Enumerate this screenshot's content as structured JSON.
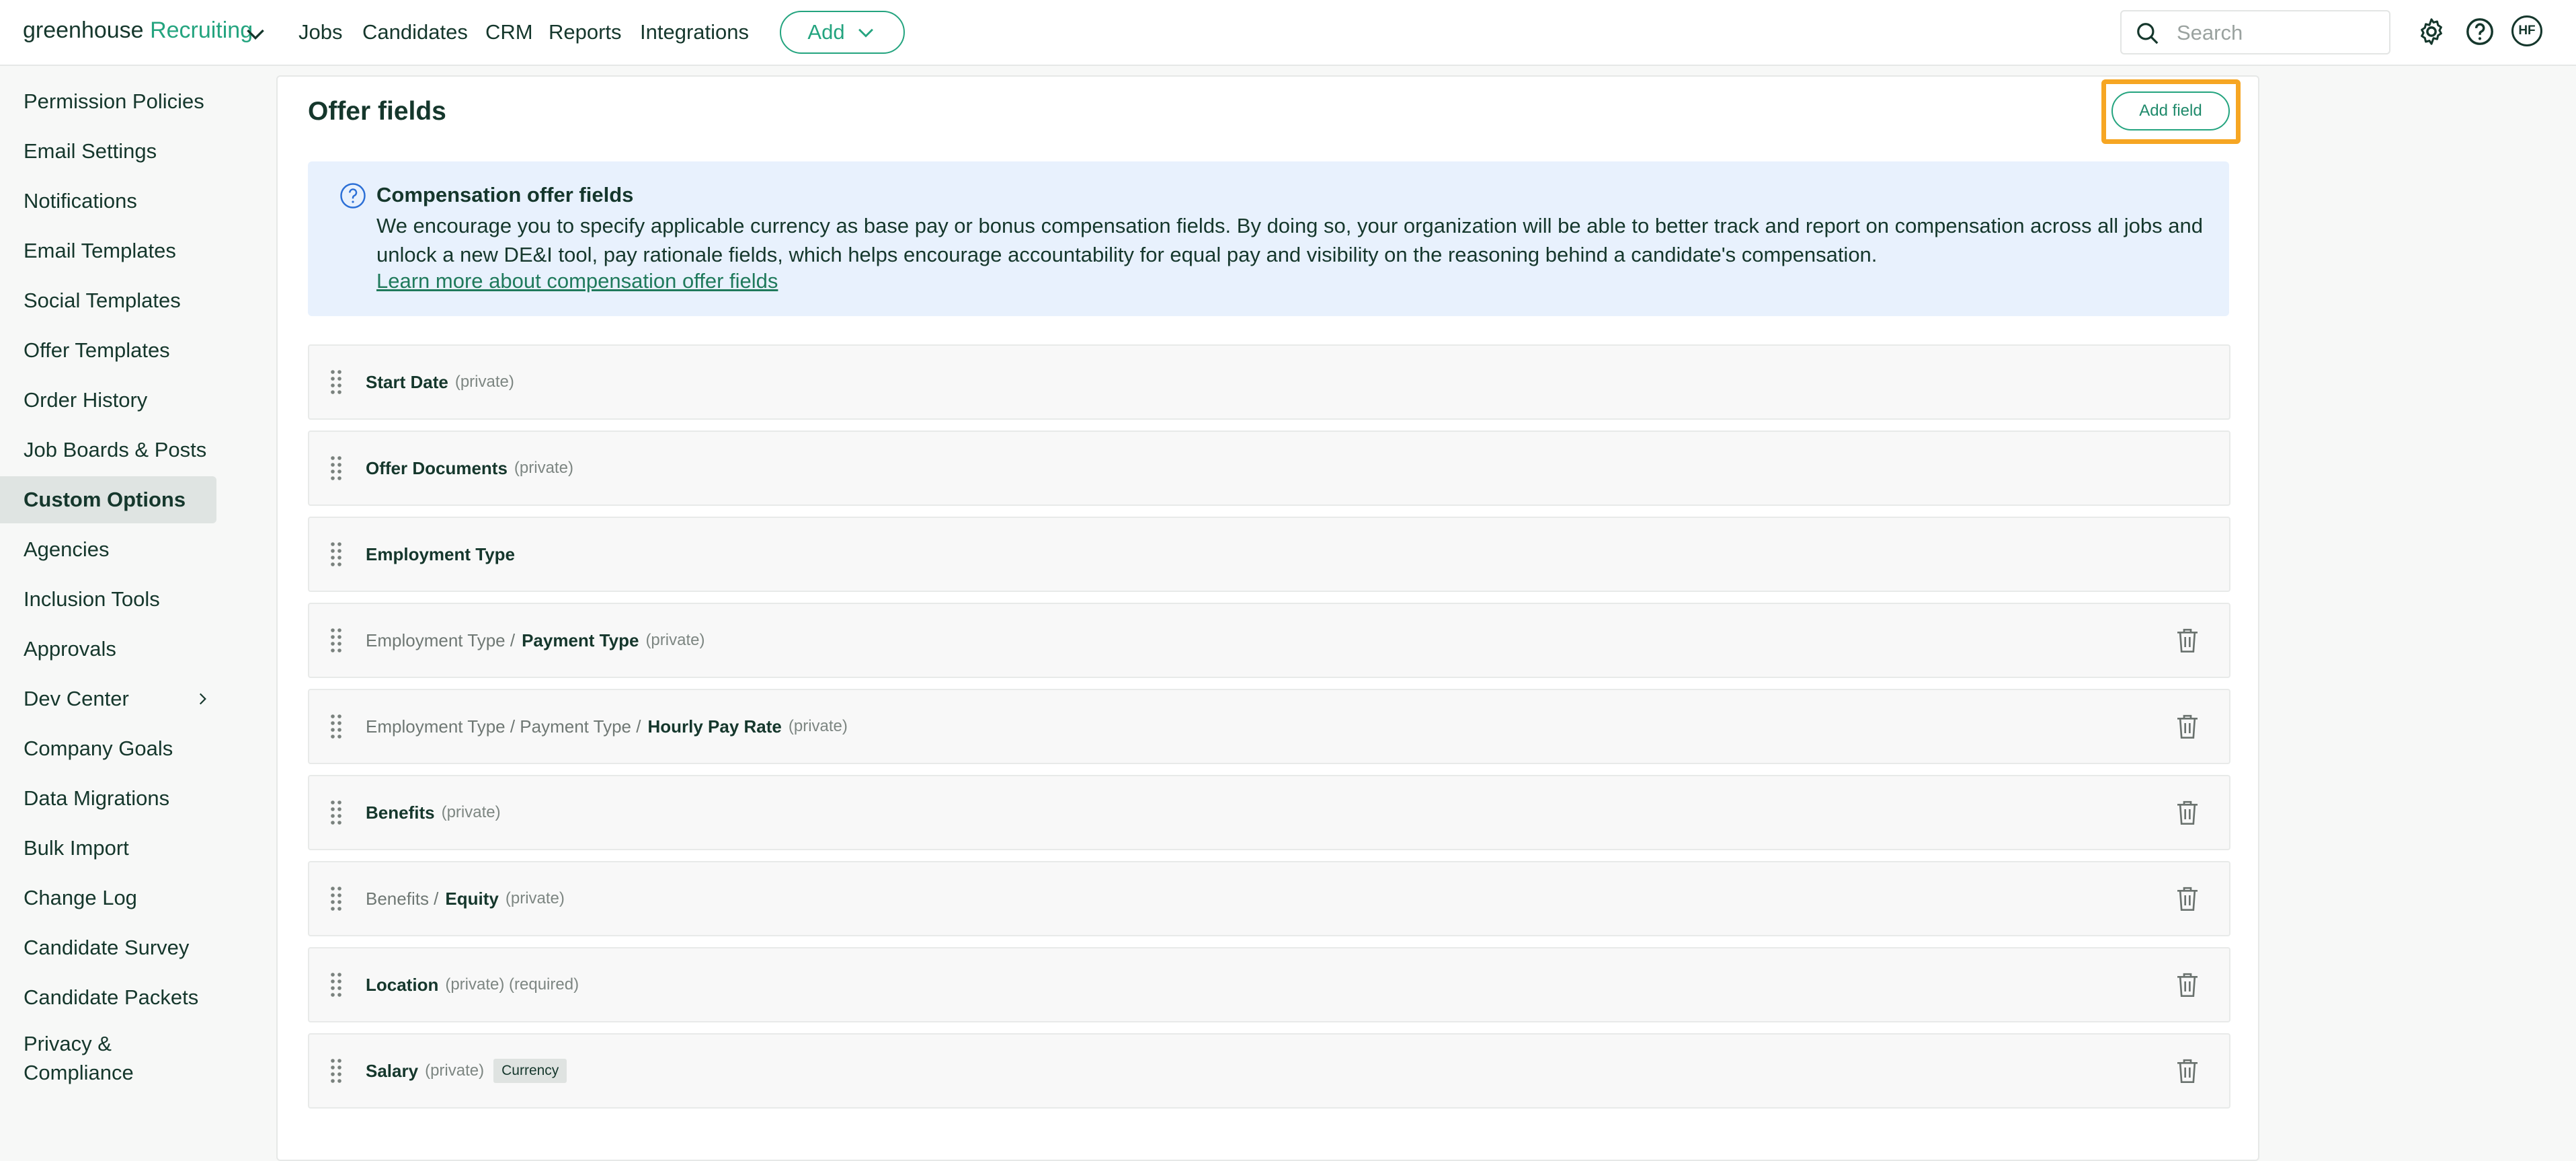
{
  "topnav": {
    "brand_main": "greenhouse",
    "brand_sub": "Recruiting",
    "links": [
      "Jobs",
      "Candidates",
      "CRM",
      "Reports",
      "Integrations"
    ],
    "add_label": "Add",
    "search_placeholder": "Search",
    "avatar_initials": "HF"
  },
  "sidebar": {
    "items": [
      "Permission Policies",
      "Email Settings",
      "Notifications",
      "Email Templates",
      "Social Templates",
      "Offer Templates",
      "Order History",
      "Job Boards & Posts",
      "Custom Options",
      "Agencies",
      "Inclusion Tools",
      "Approvals",
      "Dev Center",
      "Company Goals",
      "Data Migrations",
      "Bulk Import",
      "Change Log",
      "Candidate Survey",
      "Candidate Packets",
      "Privacy & Compliance"
    ],
    "active": "Custom Options"
  },
  "main": {
    "title": "Offer fields",
    "add_field_label": "Add field",
    "info": {
      "title": "Compensation offer fields",
      "text": "We encourage you to specify applicable currency as base pay or bonus compensation fields. By doing so, your organization will be able to better track and report on compensation across all jobs and unlock a new DE&I tool, pay rationale fields, which helps encourage accountability for equal pay and visibility on the reasoning behind a candidate's compensation.",
      "link": "Learn more about compensation offer fields"
    },
    "fields": [
      {
        "parent": "",
        "name": "Start Date",
        "tags": "(private)",
        "badge": "",
        "deletable": false
      },
      {
        "parent": "",
        "name": "Offer Documents",
        "tags": "(private)",
        "badge": "",
        "deletable": false
      },
      {
        "parent": "",
        "name": "Employment Type",
        "tags": "",
        "badge": "",
        "deletable": false
      },
      {
        "parent": "Employment Type /",
        "name": "Payment Type",
        "tags": "(private)",
        "badge": "",
        "deletable": true
      },
      {
        "parent": "Employment Type / Payment Type /",
        "name": "Hourly Pay Rate",
        "tags": "(private)",
        "badge": "",
        "deletable": true
      },
      {
        "parent": "",
        "name": "Benefits",
        "tags": "(private)",
        "badge": "",
        "deletable": true
      },
      {
        "parent": "Benefits /",
        "name": "Equity",
        "tags": "(private)",
        "badge": "",
        "deletable": true
      },
      {
        "parent": "",
        "name": "Location",
        "tags": "(private) (required)",
        "badge": "",
        "deletable": true
      },
      {
        "parent": "",
        "name": "Salary",
        "tags": "(private)",
        "badge": "Currency",
        "deletable": true
      }
    ]
  },
  "colors": {
    "brand_green": "#24a47f",
    "highlight_orange": "#f6a623",
    "info_bg": "#e8f1fd",
    "text_dark": "#15372c"
  }
}
